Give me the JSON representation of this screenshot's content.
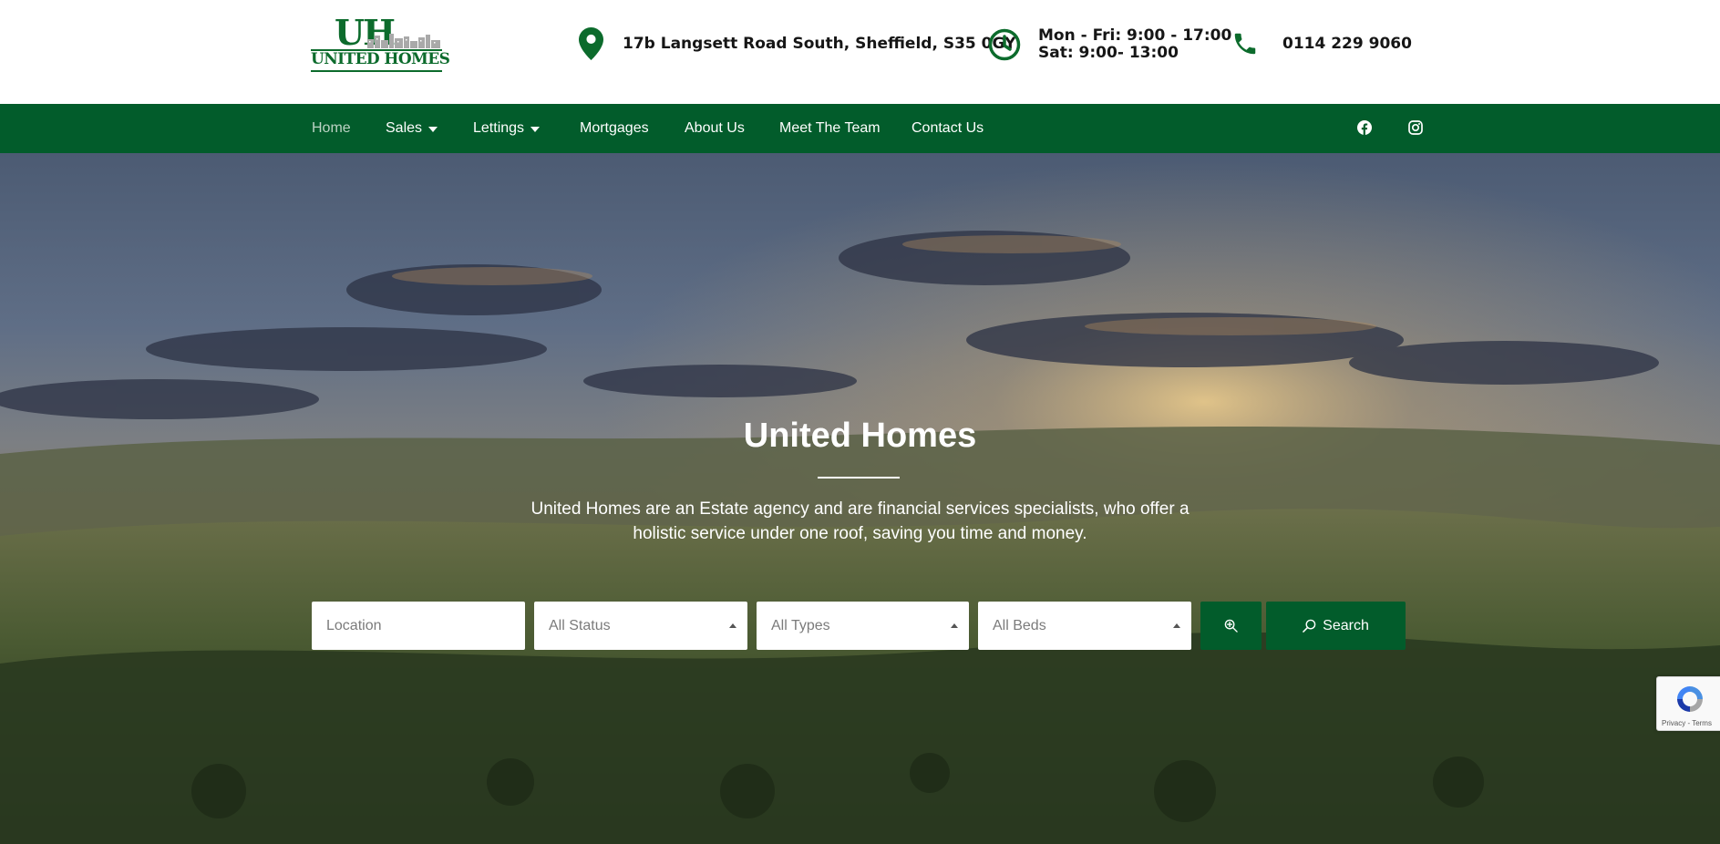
{
  "header": {
    "logo": {
      "monogram": "UH",
      "name": "UNITED HOMES"
    },
    "address": "17b Langsett Road South, Sheffield, S35 0GY",
    "hours": {
      "weekday": "Mon - Fri: 9:00 - 17:00",
      "saturday": "Sat: 9:00- 13:00"
    },
    "phone": "0114 229 9060",
    "icons": {
      "address": "map-pin-icon",
      "hours": "clock-icon",
      "phone": "phone-icon"
    }
  },
  "nav": {
    "items": [
      {
        "label": "Home",
        "active": true
      },
      {
        "label": "Sales",
        "dropdown": true
      },
      {
        "label": "Lettings",
        "dropdown": true
      },
      {
        "label": "Mortgages"
      },
      {
        "label": "About Us"
      },
      {
        "label": "Meet The Team"
      },
      {
        "label": "Contact Us"
      }
    ],
    "social": [
      "facebook-icon",
      "instagram-icon"
    ]
  },
  "hero": {
    "title": "United Homes",
    "description": "United Homes are an Estate agency and are financial services specialists, who offer a holistic service under one roof, saving you time and money."
  },
  "search": {
    "location_placeholder": "Location",
    "status": "All Status",
    "types": "All Types",
    "beds": "All Beds",
    "advanced_icon": "zoom-in-icon",
    "button_label": "Search"
  },
  "recaptcha": {
    "legal": "Privacy - Terms"
  },
  "colors": {
    "brand_green": "#025c2b",
    "logo_green": "#0c6b2c",
    "text_dark": "#161616",
    "white": "#ffffff"
  }
}
